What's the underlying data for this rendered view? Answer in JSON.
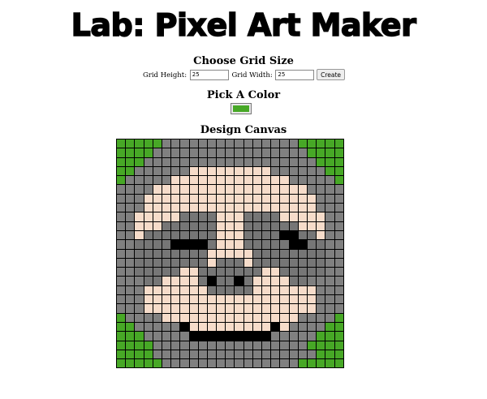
{
  "header": {
    "title": "Lab: Pixel Art Maker"
  },
  "grid_size": {
    "title": "Choose Grid Size",
    "height_label": "Grid Height:",
    "height_value": "25",
    "width_label": "Grid Width:",
    "width_value": "25",
    "create_label": "Create"
  },
  "color_picker": {
    "title": "Pick A Color",
    "selected_color": "#47a826"
  },
  "canvas": {
    "title": "Design Canvas",
    "rows": 25,
    "cols": 25,
    "palette": {
      "W": "#ffffff",
      "G": "#808080",
      "N": "#47a826",
      "D": "#767676",
      "P": "#f6dcca",
      "B": "#000000"
    },
    "pixels": [
      "NNNNNGGGGGGGGGGGGGGGNNNNN",
      "NNNNGGGGGGGGGGGGGGGGGNNNN",
      "NNNGGGGGGGGGGGGGGGGGGGNNN",
      "NNGGGGGGPPPPPPPPPGGGGGGNN",
      "NGGGGGPPPPPPPPPPPPPGGGGGN",
      "GGGGPPPPPPPPPPPPPPPPPGGGG",
      "GGGPPPPPPPPPPPPPPPPPPPGGG",
      "GGGPPPPPPPPPPPPPPPPPPPGGG",
      "GGPPPPPDDDDPPPDDDDPPPPPGG",
      "GGPPPDDDDDDPPPDDDDDDPPPGG",
      "GGPDDDDDDDDPPPDDDDBBDDPGG",
      "GGDDDDBBBBDPPPDDDDDBBDDGG",
      "GGDDDDDDDDPPPPPDDDDDDDDGG",
      "GGDDDDDDDDPDDDPDDDDDDDDGG",
      "GGDDDDDPPDDDDDDDPPDDDDDGG",
      "GGGDDPPPPDBDDBDPPPPDDGGGG",
      "GGGPPPPPPPDDDDDPPPPPPPGGG",
      "GGGPPPPPPPPPPPPPPPPPPPGGG",
      "GGGPPPPPPPPPPPPPPPPPPPGGG",
      "NGGGGPPPPPPPPPPPPPPPGGGGN",
      "NNGGGGGBPPPPPPPPPBPGGGGNN",
      "NNNGGGGGBBBBBBBBBGGGGGNNN",
      "NNNNGGGGGGGGGGGGGGGGGNNNN",
      "NNNNGGGGGGGGGGGGGGGGGGNNN",
      "NNNNNGGGGGGGGGGGGGGGNNNNN"
    ]
  }
}
